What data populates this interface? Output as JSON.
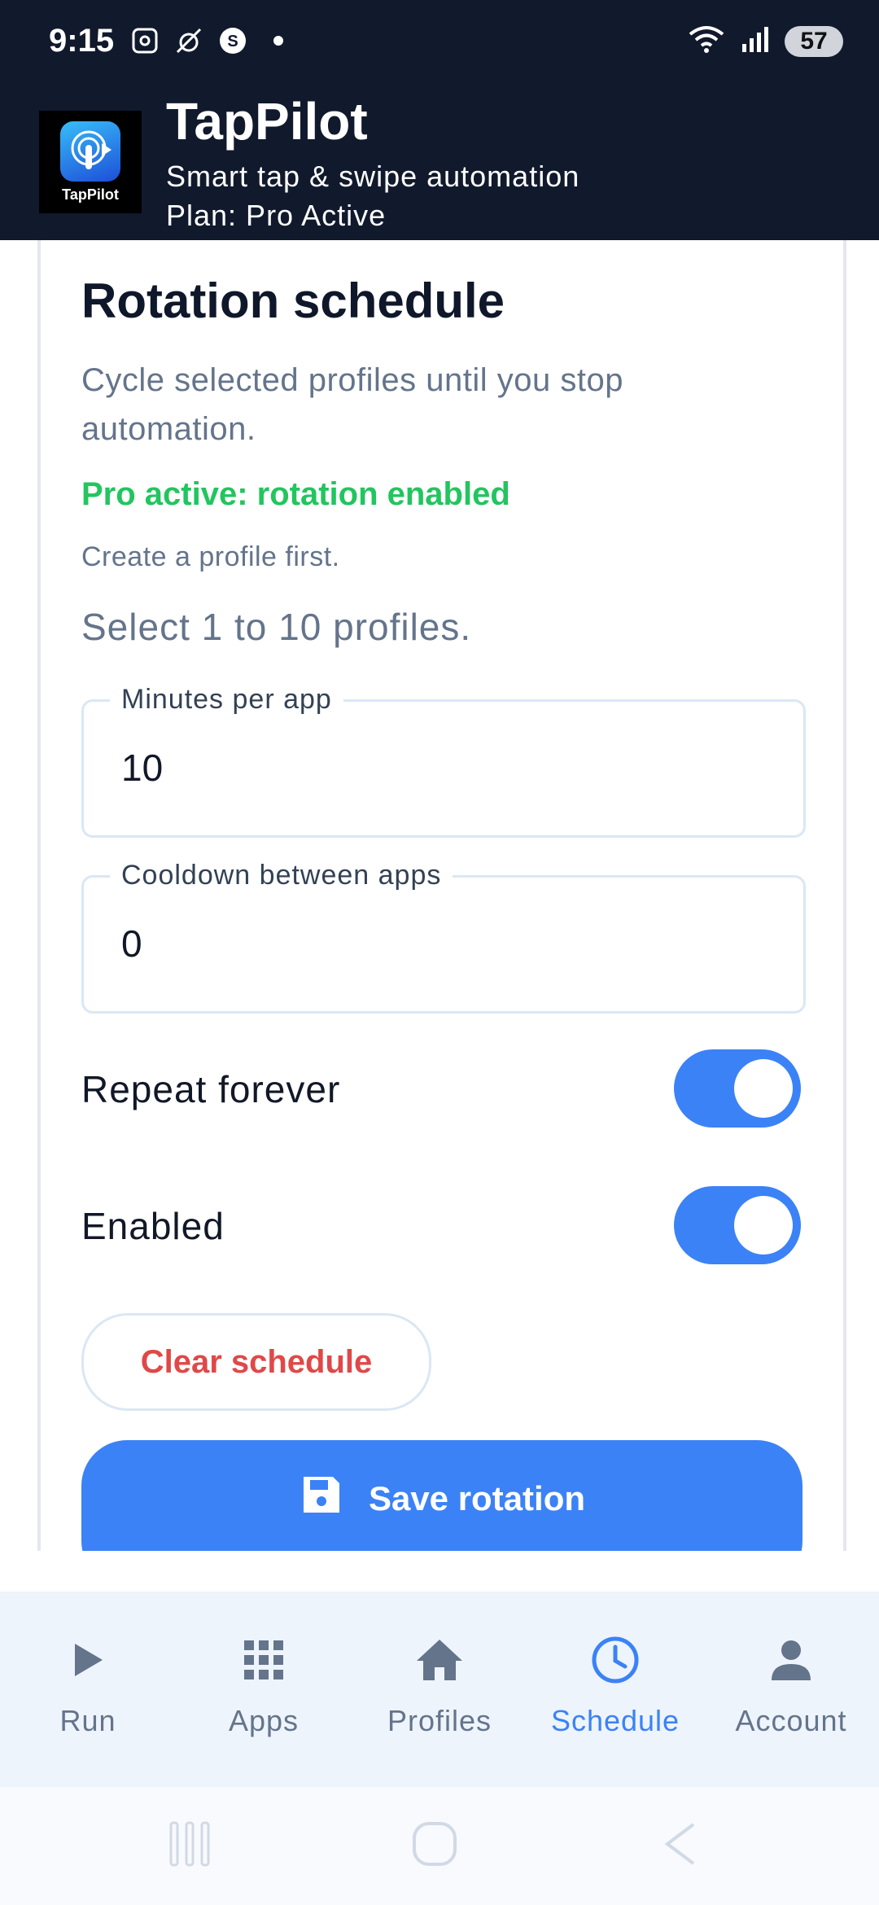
{
  "status_bar": {
    "time": "9:15",
    "battery": "57",
    "icons": [
      "screenshot-icon",
      "no-signal-icon",
      "s-icon",
      "notification-dot",
      "wifi-icon",
      "signal-icon"
    ]
  },
  "header": {
    "logo_text": "TapPilot",
    "title": "TapPilot",
    "subtitle": "Smart tap & swipe automation",
    "plan": "Plan: Pro Active",
    "background": "#111a2c"
  },
  "card": {
    "title": "Rotation schedule",
    "description": "Cycle selected profiles until you stop automation.",
    "pro_status": "Pro active: rotation enabled",
    "hint": "Create a profile first.",
    "select_hint": "Select 1 to 10 profiles.",
    "minutes_field": {
      "label": "Minutes per app",
      "value": "10"
    },
    "cooldown_field": {
      "label": "Cooldown between apps",
      "value": "0"
    },
    "repeat_toggle": {
      "label": "Repeat forever",
      "on": true
    },
    "enabled_toggle": {
      "label": "Enabled",
      "on": true
    },
    "clear_button": "Clear schedule",
    "save_button": "Save rotation"
  },
  "bottom_nav": {
    "items": [
      {
        "label": "Run",
        "icon": "play-icon",
        "active": false
      },
      {
        "label": "Apps",
        "icon": "grid-icon",
        "active": false
      },
      {
        "label": "Profiles",
        "icon": "home-icon",
        "active": false
      },
      {
        "label": "Schedule",
        "icon": "clock-icon",
        "active": true
      },
      {
        "label": "Account",
        "icon": "person-icon",
        "active": false
      }
    ]
  },
  "colors": {
    "accent": "#3b82f6",
    "success": "#22c55e",
    "danger": "#e04848",
    "muted": "#64748b"
  }
}
